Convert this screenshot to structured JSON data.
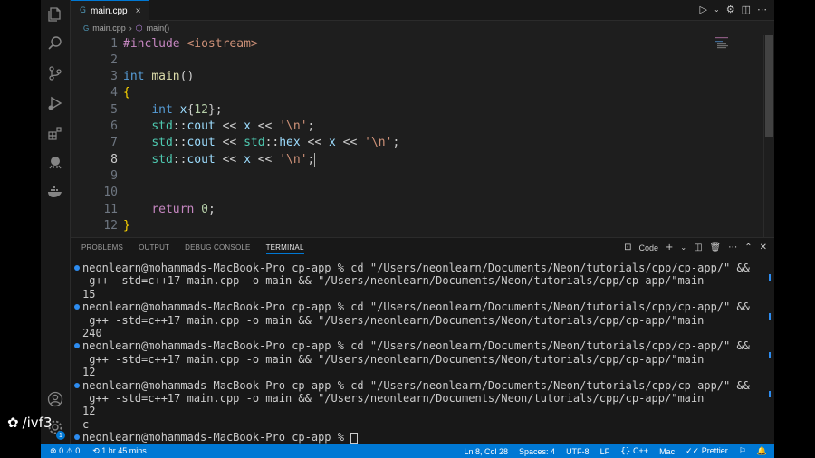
{
  "tab": {
    "filename": "main.cpp",
    "close": "×"
  },
  "breadcrumb": {
    "file": "main.cpp",
    "separator": "›",
    "symbol": "main()"
  },
  "editor": {
    "line_numbers": [
      "1",
      "2",
      "3",
      "4",
      "5",
      "6",
      "7",
      "8",
      "9",
      "10",
      "11",
      "12"
    ],
    "active_line": "8"
  },
  "panel": {
    "tabs": [
      "PROBLEMS",
      "OUTPUT",
      "DEBUG CONSOLE",
      "TERMINAL"
    ],
    "active_tab": "TERMINAL",
    "terminal_profile": "Code"
  },
  "terminal": {
    "lines": [
      "neonlearn@mohammads-MacBook-Pro cp-app % cd \"/Users/neonlearn/Documents/Neon/tutorials/cpp/cp-app/\" &&",
      " g++ -std=c++17 main.cpp -o main && \"/Users/neonlearn/Documents/Neon/tutorials/cpp/cp-app/\"main",
      "15",
      "neonlearn@mohammads-MacBook-Pro cp-app % cd \"/Users/neonlearn/Documents/Neon/tutorials/cpp/cp-app/\" &&",
      " g++ -std=c++17 main.cpp -o main && \"/Users/neonlearn/Documents/Neon/tutorials/cpp/cp-app/\"main",
      "240",
      "neonlearn@mohammads-MacBook-Pro cp-app % cd \"/Users/neonlearn/Documents/Neon/tutorials/cpp/cp-app/\" &&",
      " g++ -std=c++17 main.cpp -o main && \"/Users/neonlearn/Documents/Neon/tutorials/cpp/cp-app/\"main",
      "12",
      "neonlearn@mohammads-MacBook-Pro cp-app % cd \"/Users/neonlearn/Documents/Neon/tutorials/cpp/cp-app/\" &&",
      " g++ -std=c++17 main.cpp -o main && \"/Users/neonlearn/Documents/Neon/tutorials/cpp/cp-app/\"main",
      "12",
      "c",
      "neonlearn@mohammads-MacBook-Pro cp-app % "
    ]
  },
  "statusbar": {
    "errors": "0",
    "warnings": "0",
    "timer": "1 hr 45 mins",
    "position": "Ln 8, Col 28",
    "spaces": "Spaces: 4",
    "encoding": "UTF-8",
    "eol": "LF",
    "language": "C++",
    "platform": "Mac",
    "formatter": "Prettier"
  },
  "overlay": {
    "watermark": "/ivf3",
    "account_badge": "1"
  },
  "colors": {
    "accent": "#0078d4",
    "editor_bg": "#1e1e1e",
    "panel_bg": "#181818"
  }
}
